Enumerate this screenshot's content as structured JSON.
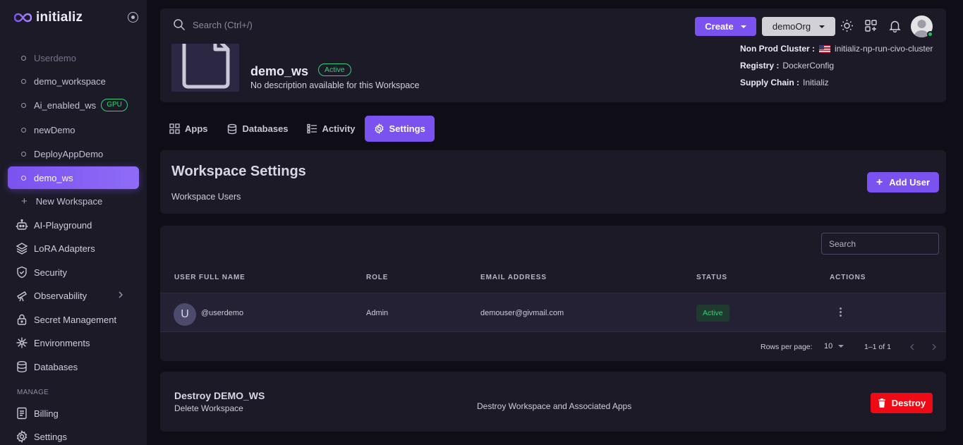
{
  "app": {
    "brand": "initializ"
  },
  "sidebar": {
    "workspaces": [
      {
        "label": "Userdemo",
        "faded": true
      },
      {
        "label": "demo_workspace"
      },
      {
        "label": "Ai_enabled_ws",
        "badge": "GPU"
      },
      {
        "label": "newDemo"
      },
      {
        "label": "DeployAppDemo"
      },
      {
        "label": "demo_ws",
        "active": true
      }
    ],
    "new_workspace": "New Workspace",
    "items": [
      {
        "label": "AI-Playground",
        "icon": "robot-icon"
      },
      {
        "label": "LoRA Adapters",
        "icon": "layers-icon"
      },
      {
        "label": "Security",
        "icon": "shield-icon"
      },
      {
        "label": "Observability",
        "icon": "telescope-icon"
      },
      {
        "label": "Secret Management",
        "icon": "lock-icon"
      },
      {
        "label": "Environments",
        "icon": "snowflake-icon"
      },
      {
        "label": "Databases",
        "icon": "database-icon"
      }
    ],
    "manage_label": "MANAGE",
    "manage_items": [
      {
        "label": "Billing",
        "icon": "billing-icon"
      },
      {
        "label": "Settings",
        "icon": "gear-icon"
      }
    ]
  },
  "topbar": {
    "search_placeholder": "Search (Ctrl+/)",
    "create_label": "Create",
    "org_label": "demoOrg",
    "icons": [
      "sun-icon",
      "apps-add-icon",
      "bell-icon",
      "avatar"
    ]
  },
  "workspace": {
    "name": "demo_ws",
    "status": "Active",
    "description": "No description available for this Workspace",
    "cluster_label": "Non Prod Cluster :",
    "cluster_value": "initializ-np-run-civo-cluster",
    "registry_label": "Registry :",
    "registry_value": "DockerConfig",
    "supply_label": "Supply Chain :",
    "supply_value": "Initializ"
  },
  "tabs": [
    {
      "label": "Apps",
      "icon": "apps-icon"
    },
    {
      "label": "Databases",
      "icon": "database-icon"
    },
    {
      "label": "Activity",
      "icon": "activity-icon"
    },
    {
      "label": "Settings",
      "icon": "gear-icon",
      "active": true
    }
  ],
  "settings": {
    "title": "Workspace Settings",
    "subtitle": "Workspace Users",
    "add_user_label": "Add User"
  },
  "users_table": {
    "search_placeholder": "Search",
    "columns": [
      "USER FULL NAME",
      "ROLE",
      "EMAIL ADDRESS",
      "STATUS",
      "ACTIONS"
    ],
    "rows": [
      {
        "initial": "U",
        "name": "@userdemo",
        "role": "Admin",
        "email": "demouser@givmail.com",
        "status": "Active"
      }
    ],
    "rows_per_page_label": "Rows per page:",
    "rows_per_page": "10",
    "range": "1–1 of 1"
  },
  "danger": {
    "title": "Destroy DEMO_WS",
    "subtitle": "Delete Workspace",
    "description": "Destroy Workspace and Associated Apps",
    "button_label": "Destroy"
  },
  "colors": {
    "accent": "#7a52f0",
    "success": "#35d07f",
    "danger": "#ee0b16"
  }
}
